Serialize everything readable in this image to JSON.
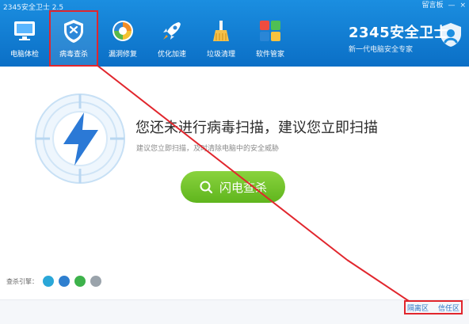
{
  "window": {
    "title": "2345安全卫士 2.5",
    "controls": [
      "留言板",
      "—",
      "×"
    ]
  },
  "nav": {
    "items": [
      {
        "label": "电脑体检",
        "icon": "monitor-icon"
      },
      {
        "label": "病毒查杀",
        "icon": "shield-icon"
      },
      {
        "label": "漏洞修复",
        "icon": "repair-icon"
      },
      {
        "label": "优化加速",
        "icon": "rocket-icon"
      },
      {
        "label": "垃圾清理",
        "icon": "broom-icon"
      },
      {
        "label": "软件管家",
        "icon": "apps-icon"
      }
    ],
    "active_index": 1
  },
  "brand": {
    "logo": "2345安全卫士",
    "tagline": "新一代电脑安全专家"
  },
  "main": {
    "headline": "您还未进行病毒扫描，建议您立即扫描",
    "subline": "建议您立即扫描，及时清除电脑中的安全威胁",
    "scan_button": "闪电查杀"
  },
  "engine": {
    "label": "查杀引擎："
  },
  "footer": {
    "links": [
      "隔离区",
      "信任区"
    ]
  },
  "colors": {
    "primary": "#1b8ee0",
    "highlight": "#e1262d",
    "scan_green": "#6cc02a",
    "bolt_blue": "#2b79d6"
  }
}
